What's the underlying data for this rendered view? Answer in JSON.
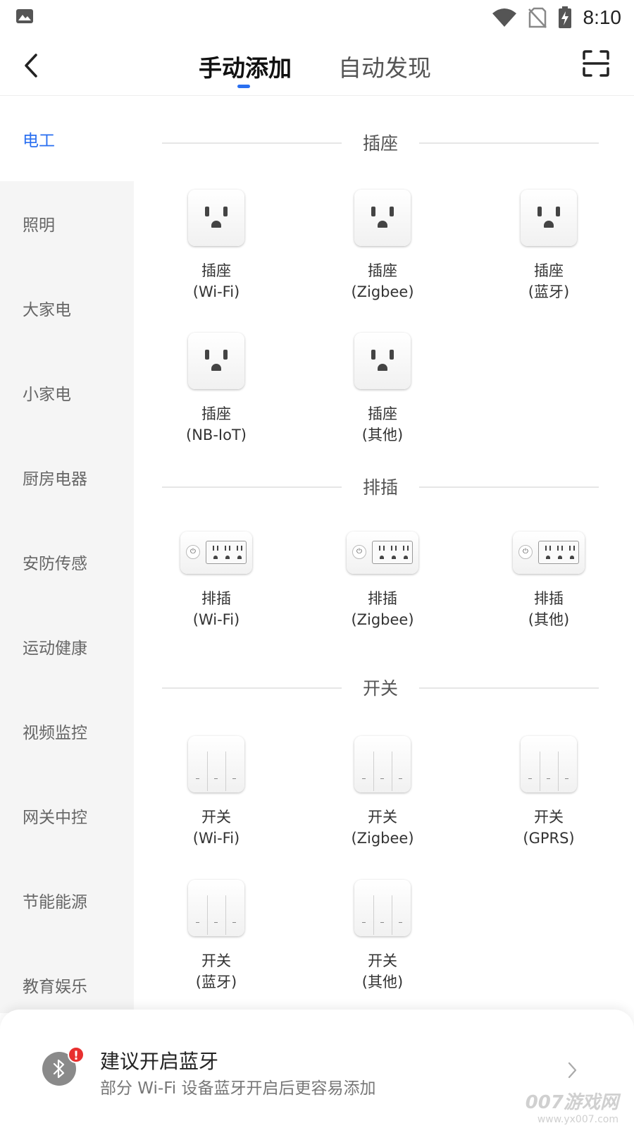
{
  "status_bar": {
    "time": "8:10"
  },
  "header": {
    "tabs": [
      {
        "label": "手动添加",
        "active": true
      },
      {
        "label": "自动发现",
        "active": false
      }
    ],
    "accent": "#2a6ff0"
  },
  "sidebar": {
    "items": [
      {
        "label": "电工",
        "active": true
      },
      {
        "label": "照明"
      },
      {
        "label": "大家电"
      },
      {
        "label": "小家电"
      },
      {
        "label": "厨房电器"
      },
      {
        "label": "安防传感"
      },
      {
        "label": "运动健康"
      },
      {
        "label": "视频监控"
      },
      {
        "label": "网关中控"
      },
      {
        "label": "节能能源"
      },
      {
        "label": "教育娱乐"
      }
    ]
  },
  "sections": [
    {
      "title": "插座",
      "devices": [
        {
          "name": "插座",
          "variant": "(Wi-Fi)",
          "icon": "socket-icon"
        },
        {
          "name": "插座",
          "variant": "(Zigbee)",
          "icon": "socket-icon"
        },
        {
          "name": "插座",
          "variant": "(蓝牙)",
          "icon": "socket-icon"
        },
        {
          "name": "插座",
          "variant": "(NB-IoT)",
          "icon": "socket-icon"
        },
        {
          "name": "插座",
          "variant": "(其他)",
          "icon": "socket-icon"
        }
      ]
    },
    {
      "title": "排插",
      "devices": [
        {
          "name": "排插",
          "variant": "(Wi-Fi)",
          "icon": "power-strip-icon"
        },
        {
          "name": "排插",
          "variant": "(Zigbee)",
          "icon": "power-strip-icon"
        },
        {
          "name": "排插",
          "variant": "(其他)",
          "icon": "power-strip-icon"
        }
      ]
    },
    {
      "title": "开关",
      "devices": [
        {
          "name": "开关",
          "variant": "(Wi-Fi)",
          "icon": "wall-switch-icon"
        },
        {
          "name": "开关",
          "variant": "(Zigbee)",
          "icon": "wall-switch-icon"
        },
        {
          "name": "开关",
          "variant": "(GPRS)",
          "icon": "wall-switch-icon"
        },
        {
          "name": "开关",
          "variant": "(蓝牙)",
          "icon": "wall-switch-icon"
        },
        {
          "name": "开关",
          "variant": "(其他)",
          "icon": "wall-switch-icon"
        }
      ]
    }
  ],
  "bluetooth_tip": {
    "title": "建议开启蓝牙",
    "subtitle": "部分 Wi-Fi 设备蓝牙开启后更容易添加",
    "badge": "!"
  },
  "watermark": {
    "brand": "007游戏网",
    "url": "www.yx007.com"
  }
}
